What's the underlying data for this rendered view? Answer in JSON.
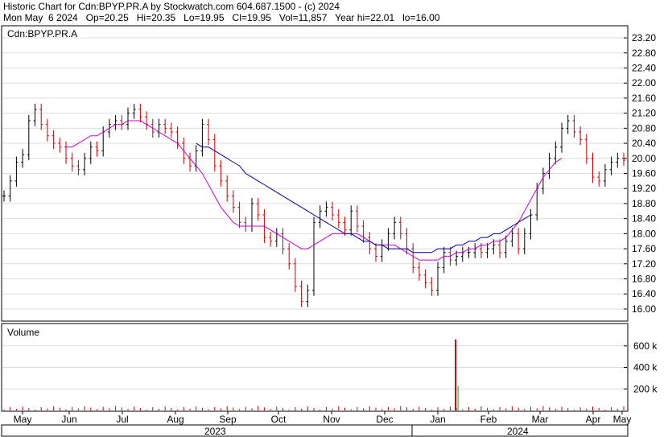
{
  "header": {
    "line1": "Historic Chart for Cdn:BPYP.PR.A by Stockwatch.com 604.687.1500 - (c) 2024",
    "line2": "Mon May  6 2024   Op=20.25   Hi=20.35   Lo=19.95   Cl=19.95   Vol=11,857   Year hi=22.01   lo=16.00"
  },
  "price_panel": {
    "symbol": "Cdn:BPYP.PR.A"
  },
  "volume_panel": {
    "label": "Volume"
  },
  "colors": {
    "up": "#000000",
    "down": "#cc0000",
    "ma_short": "#cc00cc",
    "ma_long": "#000099",
    "volume": "#cc0000",
    "volume_alt": "#00aa00",
    "grid": "#dddddd"
  },
  "chart_data": [
    {
      "type": "ohlc",
      "title": "Cdn:BPYP.PR.A",
      "ylim": [
        15.7,
        23.5
      ],
      "y_ticks": [
        "23.20",
        "22.80",
        "22.40",
        "22.00",
        "21.60",
        "21.20",
        "20.80",
        "20.40",
        "20.00",
        "19.60",
        "19.20",
        "18.80",
        "18.40",
        "18.00",
        "17.60",
        "17.20",
        "16.80",
        "16.40",
        "16.00"
      ],
      "x_ticks": [
        "May",
        "Jun",
        "Jul",
        "Aug",
        "Sep",
        "Oct",
        "Nov",
        "Dec",
        "Jan",
        "Feb",
        "Mar",
        "Apr",
        "May"
      ],
      "x_years": [
        "2023",
        "2024"
      ],
      "series": [
        {
          "name": "",
          "kind": "close",
          "values": [
            19.0,
            19.4,
            19.9,
            20.1,
            21.0,
            21.3,
            20.9,
            20.6,
            20.4,
            20.3,
            20.0,
            19.8,
            19.7,
            20.0,
            20.3,
            20.2,
            20.7,
            20.9,
            21.0,
            20.9,
            21.2,
            21.3,
            21.1,
            20.9,
            20.7,
            20.9,
            20.8,
            20.7,
            20.4,
            20.0,
            19.8,
            20.2,
            20.9,
            20.5,
            19.8,
            19.4,
            19.0,
            18.7,
            18.3,
            18.2,
            18.8,
            18.5,
            17.9,
            17.8,
            18.0,
            17.6,
            17.2,
            16.6,
            16.2,
            16.5,
            18.3,
            18.6,
            18.7,
            18.5,
            18.3,
            18.1,
            18.6,
            18.2,
            17.9,
            17.6,
            17.4,
            17.7,
            18.0,
            18.3,
            18.0,
            17.6,
            17.1,
            16.9,
            16.7,
            16.5,
            17.1,
            17.5,
            17.3,
            17.4,
            17.5,
            17.5,
            17.6,
            17.5,
            17.6,
            17.7,
            17.5,
            17.8,
            18.0,
            17.6,
            18.0,
            18.5,
            19.2,
            19.6,
            20.0,
            20.3,
            20.8,
            21.0,
            20.7,
            20.5,
            20.0,
            19.5,
            19.4,
            19.7,
            19.9,
            20.0,
            19.95
          ]
        },
        {
          "name": "",
          "kind": "moving-average-short",
          "values": [
            null,
            null,
            null,
            null,
            null,
            null,
            null,
            null,
            null,
            null,
            20.3,
            20.3,
            20.4,
            20.5,
            20.6,
            20.6,
            20.7,
            20.8,
            20.9,
            20.9,
            21.0,
            21.0,
            21.0,
            20.9,
            20.8,
            20.7,
            20.6,
            20.5,
            20.4,
            20.2,
            20.0,
            19.8,
            19.6,
            19.3,
            19.0,
            18.7,
            18.5,
            18.3,
            18.2,
            18.2,
            18.2,
            18.2,
            18.2,
            18.1,
            18.0,
            17.9,
            17.8,
            17.7,
            17.6,
            17.6,
            17.7,
            17.8,
            17.9,
            18.0,
            18.0,
            18.0,
            18.0,
            18.0,
            17.9,
            17.8,
            17.7,
            17.7,
            17.7,
            17.7,
            17.6,
            17.5,
            17.4,
            17.3,
            17.3,
            17.3,
            17.3,
            17.4,
            17.4,
            17.5,
            17.5,
            17.6,
            17.6,
            17.7,
            17.7,
            17.8,
            17.8,
            17.9,
            18.1,
            18.3,
            18.6,
            18.9,
            19.2,
            19.5,
            19.7,
            19.9,
            20.0
          ]
        },
        {
          "name": "",
          "kind": "moving-average-long",
          "values": [
            null,
            null,
            null,
            null,
            null,
            null,
            null,
            null,
            null,
            null,
            null,
            null,
            null,
            null,
            null,
            null,
            null,
            null,
            null,
            null,
            null,
            null,
            null,
            null,
            null,
            null,
            null,
            null,
            null,
            null,
            null,
            20.4,
            20.3,
            20.3,
            20.2,
            20.1,
            20.0,
            19.9,
            19.8,
            19.6,
            19.5,
            19.4,
            19.3,
            19.2,
            19.1,
            19.0,
            18.9,
            18.8,
            18.7,
            18.6,
            18.5,
            18.4,
            18.3,
            18.2,
            18.1,
            18.0,
            18.0,
            17.9,
            17.8,
            17.8,
            17.7,
            17.7,
            17.6,
            17.6,
            17.6,
            17.6,
            17.5,
            17.5,
            17.5,
            17.5,
            17.6,
            17.6,
            17.6,
            17.7,
            17.7,
            17.8,
            17.8,
            17.9,
            17.9,
            18.0,
            18.0,
            18.1,
            18.2,
            18.3,
            18.4,
            18.5
          ]
        }
      ]
    },
    {
      "type": "bar",
      "title": "Volume",
      "ylim": [
        0,
        800000
      ],
      "y_ticks": [
        "600 k",
        "400 k",
        "200 k"
      ],
      "notes": "Mostly very small daily volume; spike of about 660 k in mid-January 2024 and about 230 k the next day.",
      "spike_values": [
        660000,
        230000
      ]
    }
  ]
}
